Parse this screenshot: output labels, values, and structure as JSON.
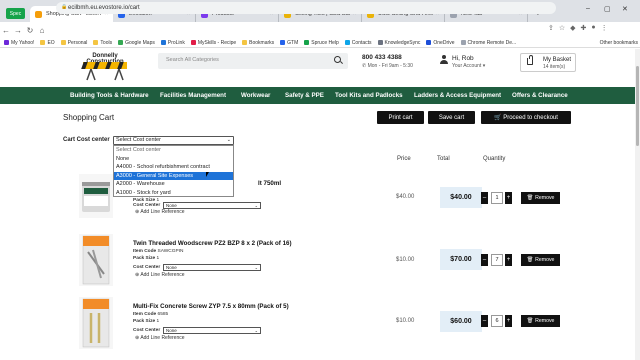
{
  "browser": {
    "badge": "Spec",
    "tabs": [
      {
        "label": "Shopping Cart - LBMH",
        "color": "#f59e0b",
        "active": true
      },
      {
        "label": "Evolution",
        "color": "#2563eb"
      },
      {
        "label": "Products",
        "color": "#7c3aed"
      },
      {
        "label": "Ceiling Tiles | CBS Bahamas",
        "color": "#eab308"
      },
      {
        "label": "USG Ceiling Grid Firecode",
        "color": "#eab308"
      },
      {
        "label": "New Tab",
        "color": "#9ca3af"
      }
    ],
    "url": "ecilbmh.eu.evostore.io/cart",
    "bookmarks": [
      "My Yahoo!",
      "EO",
      "Personal",
      "Tools",
      "Google Maps",
      "ProLink",
      "MySkills - Recipe",
      "Bookmarks",
      "GTM",
      "Spruce Help",
      "Contacts",
      "KnowledgeSync",
      "OneDrive",
      "Chrome Remote De..."
    ],
    "other_bookmarks": "Other bookmarks"
  },
  "header": {
    "logo_text": "Donnelly Construction",
    "search_placeholder": "Search All Categories",
    "phone": "800 433 4388",
    "hours": "Mon - Fri 9am - 5:30",
    "greeting": "Hi, Rob",
    "account_link": "Your Account",
    "basket_title": "My Basket",
    "basket_count": "14 item(s)"
  },
  "nav": [
    "Building Tools & Hardware",
    "Facilities Management",
    "Workwear",
    "Safety & PPE",
    "Tool Kits and Padlocks",
    "Ladders & Access Equipment",
    "Offers & Clearance"
  ],
  "cart": {
    "title": "Shopping Cart",
    "print_label": "Print cart",
    "save_label": "Save cart",
    "checkout_label": "Proceed to checkout",
    "cost_center_label": "Cart Cost center",
    "cost_center_value": "Select Cost center",
    "cost_center_options": [
      "Select Cost center",
      "None",
      "A4000 - School refurbishment contract",
      "A3000 - General Site Expenses",
      "A2000 - Warehouse",
      "A1000 - Stock for yard"
    ],
    "columns": {
      "price": "Price",
      "total": "Total",
      "quantity": "Quantity"
    },
    "item_code_label": "Item Code",
    "pack_size_label": "Pack Size",
    "row_cc_label": "Cost Center",
    "row_cc_value": "None",
    "add_ref_label": "Add Line Reference",
    "remove_label": "Remove",
    "items": [
      {
        "name": "lt 750ml",
        "code": "",
        "pack": "1",
        "price": "$40.00",
        "total": "$40.00",
        "qty": "1"
      },
      {
        "name": "Twin Threaded Woodscrew PZ2 BZP 8 x 2 (Pack of 16)",
        "code": "SAWCGPIN",
        "pack": "1",
        "price": "$10.00",
        "total": "$70.00",
        "qty": "7"
      },
      {
        "name": "Multi-Fix Concrete Screw ZYP 7.5 x 80mm (Pack of 5)",
        "code": "6585",
        "pack": "1",
        "price": "$10.00",
        "total": "$60.00",
        "qty": "6"
      }
    ]
  }
}
